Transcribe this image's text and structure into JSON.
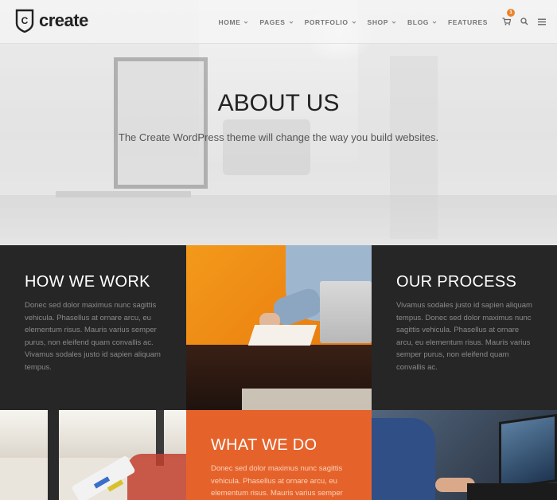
{
  "brand": {
    "name": "create",
    "logo_letter": "C"
  },
  "nav": {
    "items": [
      {
        "label": "HOME",
        "has_dropdown": true
      },
      {
        "label": "PAGES",
        "has_dropdown": true
      },
      {
        "label": "PORTFOLIO",
        "has_dropdown": true
      },
      {
        "label": "SHOP",
        "has_dropdown": true
      },
      {
        "label": "BLOG",
        "has_dropdown": true
      },
      {
        "label": "FEATURES",
        "has_dropdown": false
      }
    ],
    "cart_count": "1",
    "icons": [
      "cart-icon",
      "search-icon",
      "menu-icon"
    ]
  },
  "hero": {
    "title": "ABOUT US",
    "subtitle": "The Create WordPress theme will change the way you build websites."
  },
  "sections": {
    "how_we_work": {
      "title": "HOW WE WORK",
      "body": "Donec sed dolor maximus nunc sagittis vehicula. Phasellus at ornare arcu, eu elementum risus. Mauris varius semper purus, non eleifend quam convallis ac. Vivamus sodales justo id sapien aliquam tempus."
    },
    "our_process": {
      "title": "OUR PROCESS",
      "body": "Vivamus sodales justo id sapien aliquam tempus. Donec sed dolor maximus nunc sagittis vehicula. Phasellus at ornare arcu, eu elementum risus. Mauris varius semper purus, non eleifend quam convallis ac."
    },
    "what_we_do": {
      "title": "WHAT WE DO",
      "body": "Donec sed dolor maximus nunc sagittis vehicula. Phasellus at ornare arcu, eu elementum risus. Mauris varius semper"
    }
  },
  "colors": {
    "accent": "#e5632b",
    "dark": "#262626",
    "badge": "#e9842b"
  }
}
